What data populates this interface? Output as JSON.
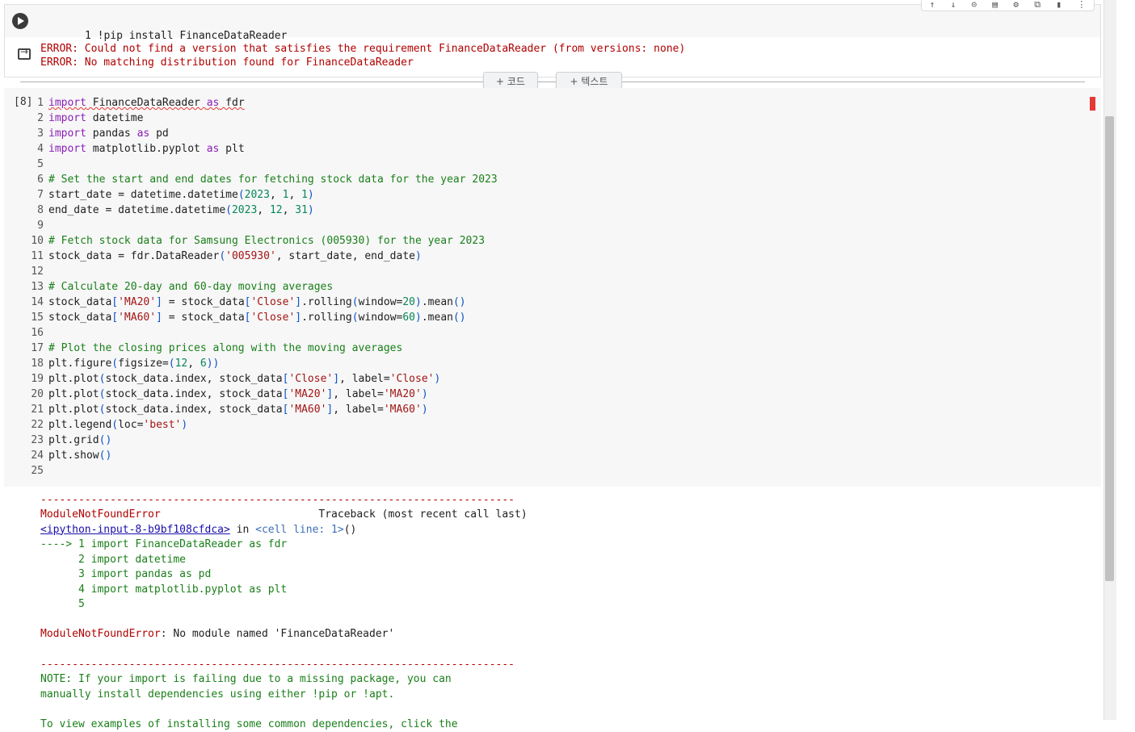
{
  "cell1": {
    "code": "1 !pip install FinanceDataReader",
    "output": [
      "ERROR: Could not find a version that satisfies the requirement FinanceDataReader (from versions: none)",
      "ERROR: No matching distribution found for FinanceDataReader"
    ]
  },
  "toolbar": {
    "icons": [
      "arrow-up-icon",
      "arrow-down-icon",
      "link-icon",
      "comment-icon",
      "gear-icon",
      "mirror-icon",
      "trash-icon",
      "more-icon"
    ],
    "glyphs": [
      "↑",
      "↓",
      "⊝",
      "▤",
      "⚙",
      "⧉",
      "▮",
      "⋮"
    ]
  },
  "add": {
    "code_label": "+ 코드",
    "text_label": "+ 텍스트"
  },
  "cell2": {
    "exec_count": "[8]"
  },
  "traceback": {
    "divider": "---------------------------------------------------------------------------",
    "error_type": "ModuleNotFoundError",
    "traceback_label": "                         Traceback (most recent call last)",
    "input_link": "<ipython-input-8-b9bf108cfdca>",
    "in_text": " in ",
    "cell_line": "<cell line: 1>",
    "cell_paren": "()",
    "arrow_line": "----> 1 import FinanceDataReader as fdr",
    "ctx": [
      "      2 import datetime",
      "      3 import pandas as pd",
      "      4 import matplotlib.pyplot as plt",
      "      5"
    ],
    "final_type": "ModuleNotFoundError",
    "final_msg": ": No module named 'FinanceDataReader'",
    "note1": "NOTE: If your import is failing due to a missing package, you can",
    "note2": "manually install dependencies using either !pip or !apt.",
    "note3": "To view examples of installing some common dependencies, click the"
  }
}
